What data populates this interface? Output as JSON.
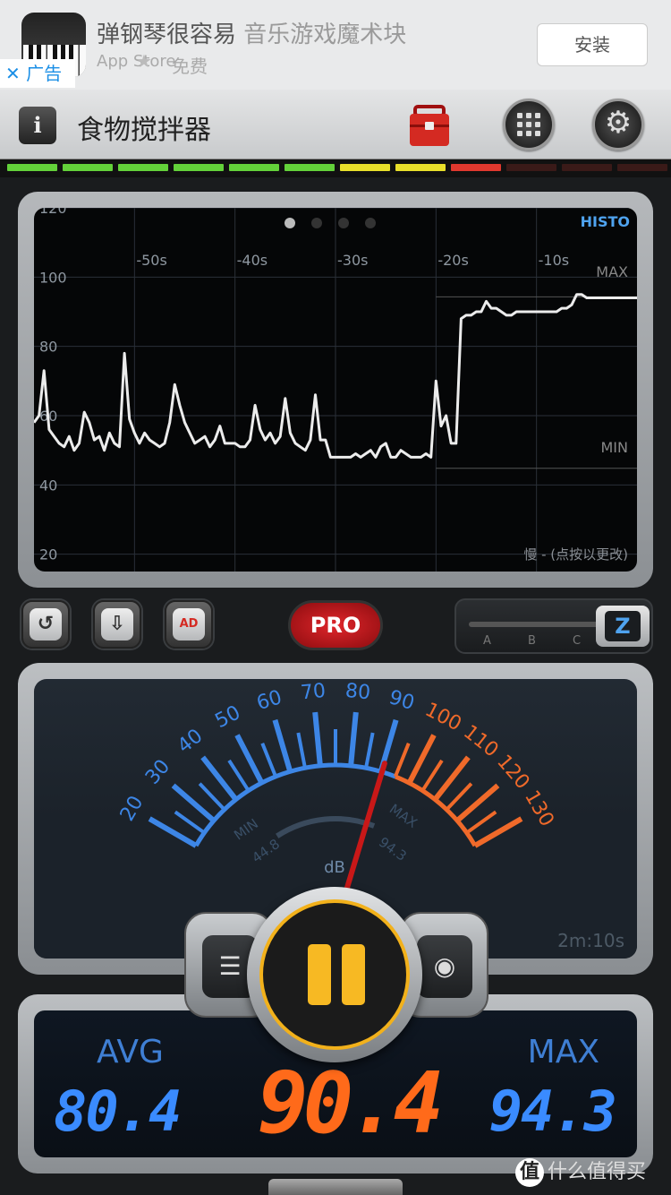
{
  "ad": {
    "title_prefix": "弹钢琴很容易",
    "title_rest": "音乐游戏魔术块",
    "source": "App Store",
    "star": "★",
    "price": "免费",
    "install": "安装",
    "badge": "广告",
    "close_glyph": "✕"
  },
  "toolbar": {
    "info": "i",
    "title": "食物搅拌器",
    "gear_glyph": "⚙"
  },
  "level_bar": {
    "colors": [
      "#63d13a",
      "#63d13a",
      "#63d13a",
      "#63d13a",
      "#63d13a",
      "#63d13a",
      "#e8df2a",
      "#e8df2a",
      "#e0382e",
      "#3a1a18",
      "#3a1a18",
      "#3a1a18"
    ],
    "lit_segments": 9
  },
  "graph": {
    "mode": "HISTO",
    "speed_label": "慢 - (点按以更改)",
    "max_label": "MAX",
    "min_label": "MIN",
    "y_ticks": [
      "120",
      "100",
      "80",
      "60",
      "40",
      "20"
    ],
    "x_ticks": [
      "-50s",
      "-40s",
      "-30s",
      "-20s",
      "-10s"
    ],
    "pages_total": 4,
    "page_active": 0
  },
  "chart_data": {
    "type": "line",
    "title": "",
    "xlabel": "",
    "ylabel": "",
    "xlim": [
      -60,
      0
    ],
    "ylim": [
      15,
      120
    ],
    "max_line": 94.3,
    "min_line": 44.8,
    "series": [
      {
        "x": [
          -60,
          -59.5,
          -59,
          -58.5,
          -58,
          -57.5,
          -57,
          -56.5,
          -56,
          -55.5,
          -55,
          -54.5,
          -54,
          -53.5,
          -53,
          -52.5,
          -52,
          -51.5,
          -51,
          -50.5,
          -50,
          -49.5,
          -49,
          -48.5,
          -48,
          -47.5,
          -47,
          -46.5,
          -46,
          -45.5,
          -45,
          -44.5,
          -44,
          -43.5,
          -43,
          -42.5,
          -42,
          -41.5,
          -41,
          -40.5,
          -40,
          -39.5,
          -39,
          -38.5,
          -38,
          -37.5,
          -37,
          -36.5,
          -36,
          -35.5,
          -35,
          -34.5,
          -34,
          -33.5,
          -33,
          -32.5,
          -32,
          -31.5,
          -31,
          -30.5,
          -30,
          -29.5,
          -29,
          -28.5,
          -28,
          -27.5,
          -27,
          -26.5,
          -26,
          -25.5,
          -25,
          -24.5,
          -24,
          -23.5,
          -23,
          -22.5,
          -22,
          -21.5,
          -21,
          -20.5,
          -20,
          -19.5,
          -19,
          -18.5,
          -18,
          -17.5,
          -17,
          -16.5,
          -16,
          -15.5,
          -15,
          -14.5,
          -14,
          -13.5,
          -13,
          -12.5,
          -12,
          -11.5,
          -11,
          -10.5,
          -10,
          -9.5,
          -9,
          -8.5,
          -8,
          -7.5,
          -7,
          -6.5,
          -6,
          -5.5,
          -5,
          -4.5,
          -4,
          -3.5,
          -3,
          -2.5,
          -2,
          -1.5,
          -1,
          -0.5,
          0
        ],
        "values": [
          58,
          60,
          73,
          56,
          54,
          52,
          51,
          54,
          50,
          52,
          61,
          58,
          53,
          54,
          50,
          55,
          52,
          51,
          78,
          59,
          55,
          52,
          55,
          53,
          52,
          51,
          52,
          58,
          69,
          63,
          58,
          55,
          52,
          53,
          54,
          51,
          53,
          57,
          52,
          52,
          52,
          51,
          51,
          53,
          63,
          56,
          53,
          55,
          52,
          54,
          65,
          55,
          52,
          51,
          50,
          53,
          66,
          53,
          53,
          48,
          48,
          48,
          48,
          48,
          49,
          48,
          49,
          50,
          48,
          51,
          52,
          48,
          48,
          50,
          49,
          48,
          48,
          48,
          49,
          48,
          70,
          57,
          60,
          52,
          52,
          88,
          89,
          89,
          90,
          90,
          93,
          91,
          91,
          90,
          89,
          89,
          90,
          90,
          90,
          90,
          90,
          90,
          90,
          90,
          90,
          91,
          91,
          92,
          95,
          95,
          94,
          94,
          94,
          94,
          94,
          94,
          94,
          94,
          94,
          94,
          94
        ]
      }
    ]
  },
  "controls": {
    "reset_glyph": "↺",
    "save_glyph": "⇩",
    "ad_glyph": "AD",
    "pro": "PRO",
    "weighting": "Z",
    "weighting_options": [
      "A",
      "B",
      "C"
    ]
  },
  "meter": {
    "ticks": [
      "20",
      "30",
      "40",
      "50",
      "60",
      "70",
      "80",
      "90",
      "100",
      "110",
      "120",
      "130"
    ],
    "unit": "dB",
    "min_label": "MIN",
    "max_label": "MAX",
    "min_value": "44.8",
    "max_value": "94.3",
    "elapsed": "2m:10s",
    "needle_value": 90.4,
    "orange_from": 100,
    "colors": {
      "blue": "#3d86e6",
      "orange": "#f06a2a",
      "needle": "#c81818"
    }
  },
  "readout": {
    "avg_label": "AVG",
    "max_label": "MAX",
    "avg_value": "80.4",
    "current_value": "90.4",
    "max_value": "94.3"
  },
  "center": {
    "log_glyph": "☰",
    "camera_glyph": "◉"
  },
  "watermark": {
    "mark": "值",
    "text": "什么值得买"
  }
}
